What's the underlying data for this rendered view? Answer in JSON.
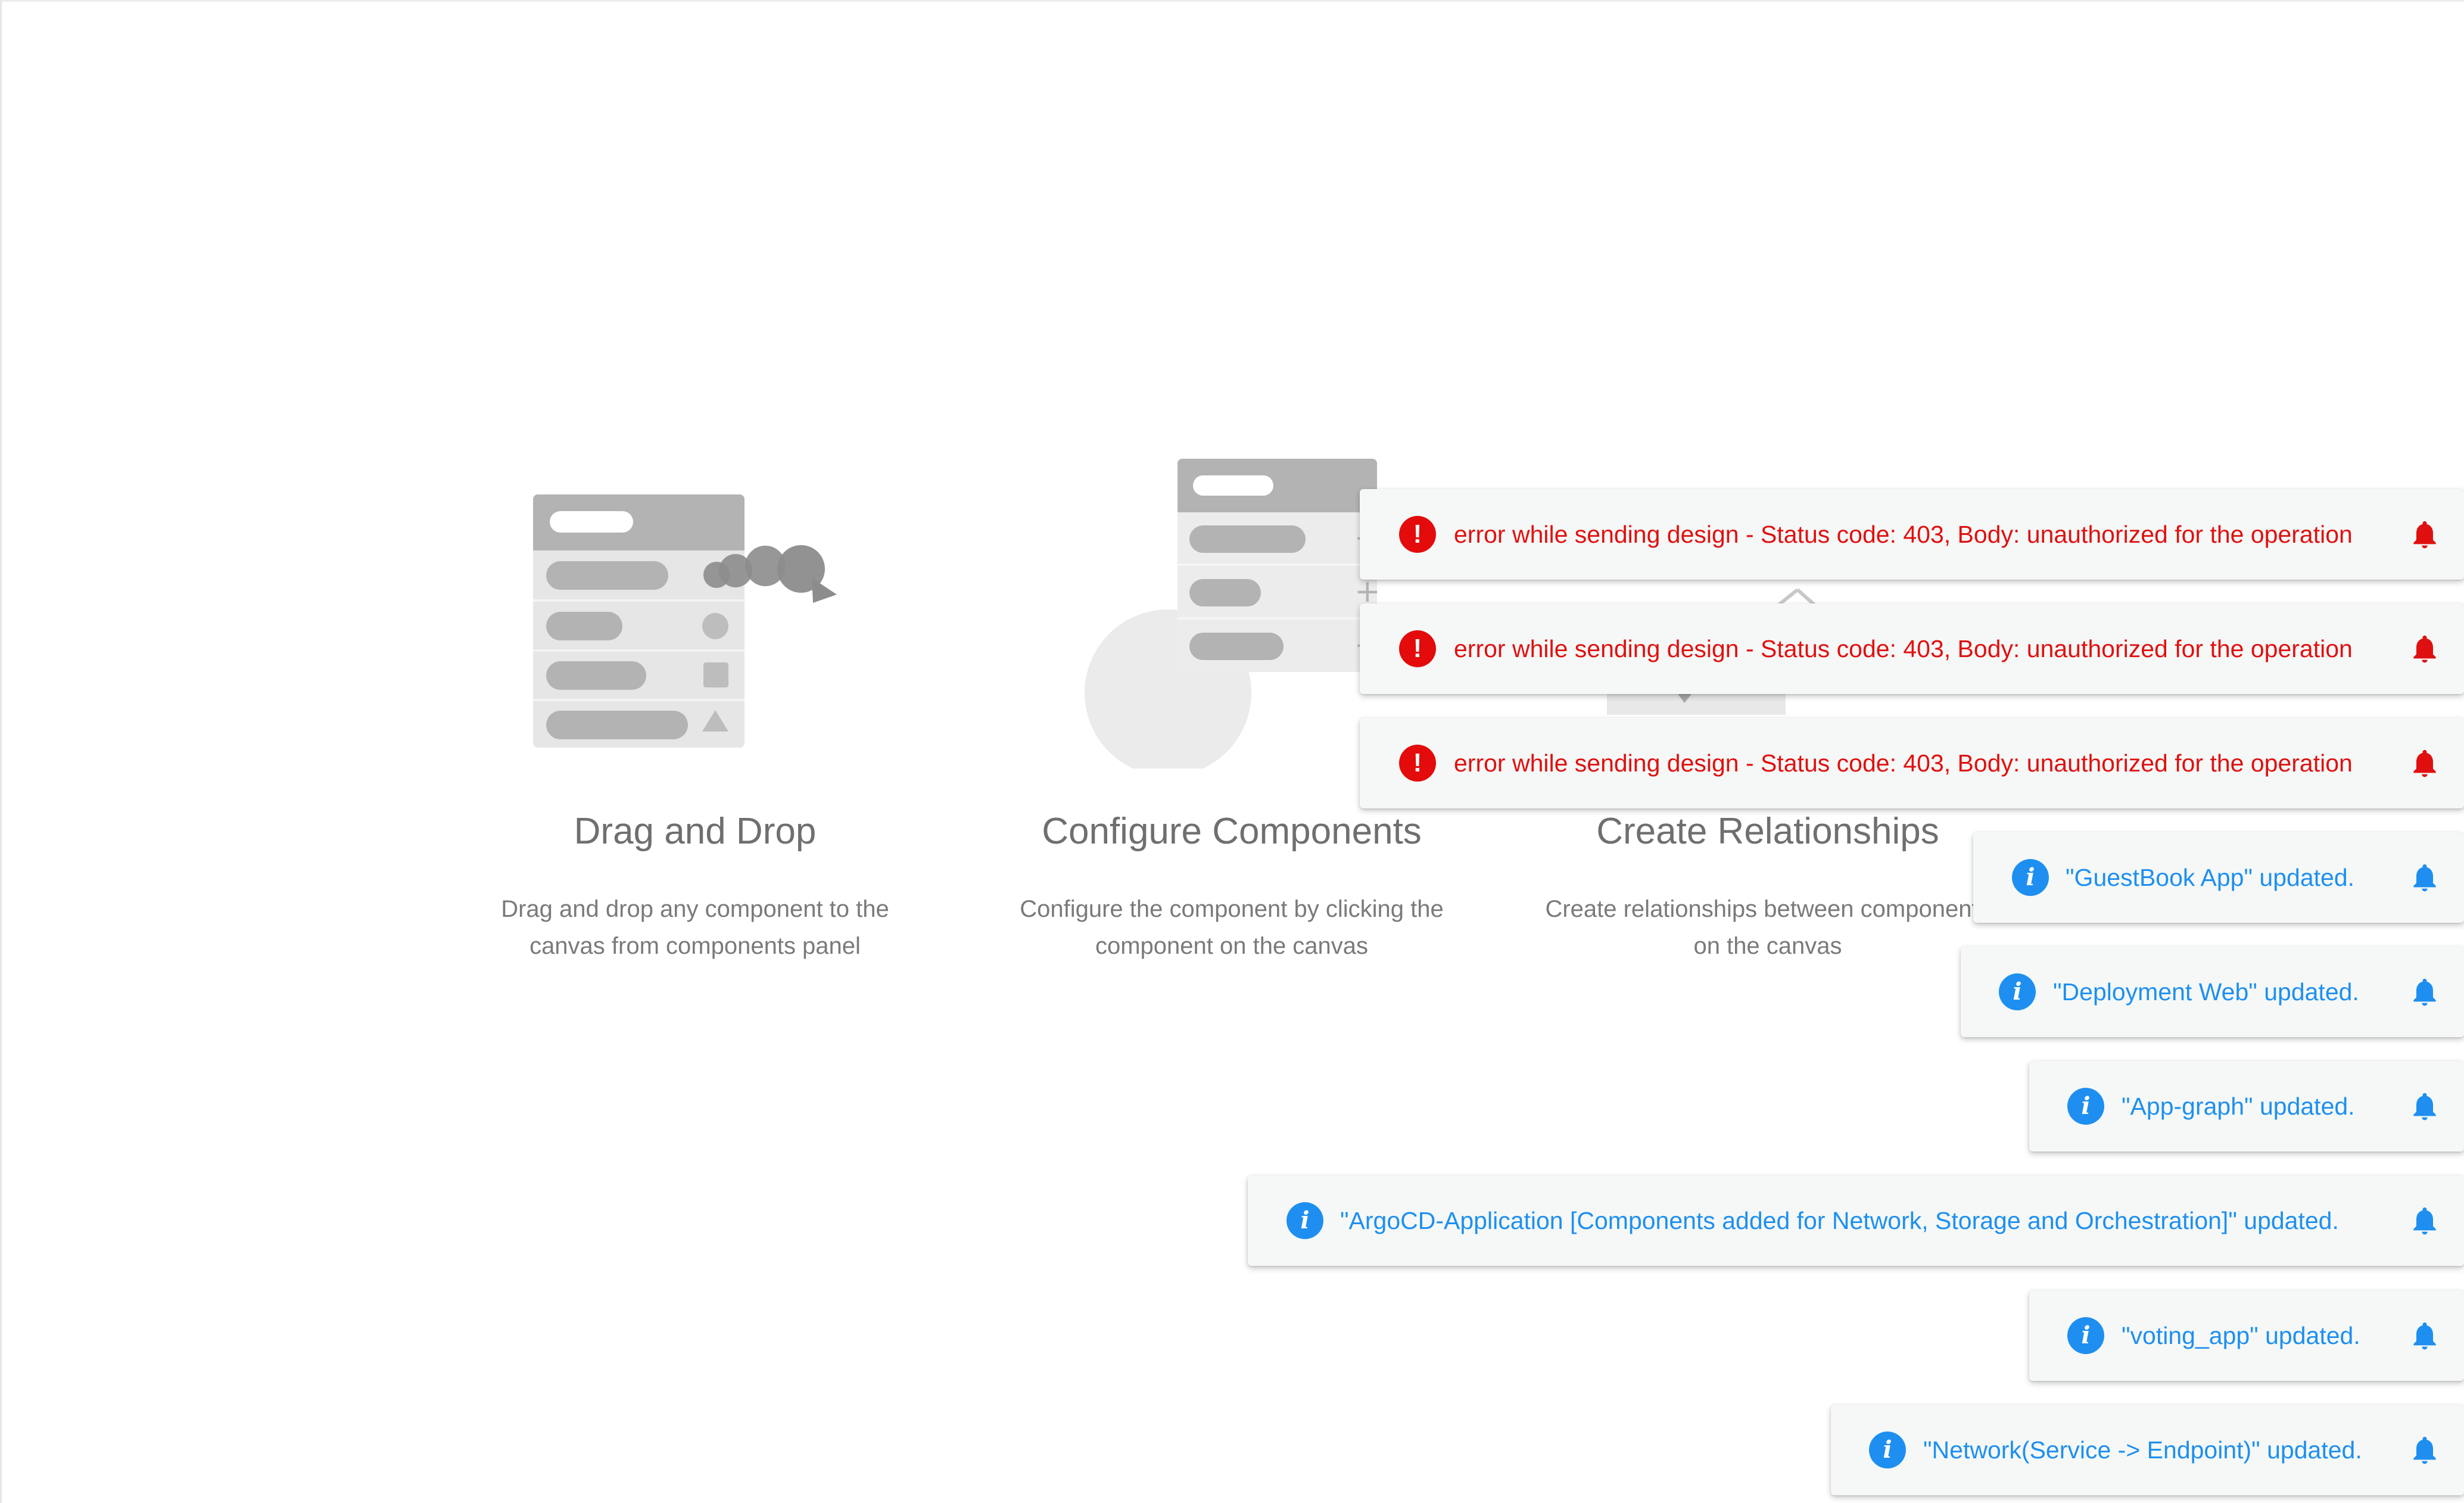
{
  "cards": [
    {
      "title": "Drag and Drop",
      "desc_line1": "Drag and drop any component to the",
      "desc_line2": "canvas from components panel"
    },
    {
      "title": "Configure Components",
      "desc_line1": "Configure the component by clicking the",
      "desc_line2": "component on the canvas"
    },
    {
      "title": "Create Relationships",
      "desc_line1": "Create relationships between components",
      "desc_line2": "on the canvas"
    }
  ],
  "notifications": [
    {
      "type": "error",
      "icon": "error-icon",
      "message": "error while sending design - Status code: 403, Body: unauthorized for the operation"
    },
    {
      "type": "error",
      "icon": "error-icon",
      "message": "error while sending design - Status code: 403, Body: unauthorized for the operation"
    },
    {
      "type": "error",
      "icon": "error-icon",
      "message": "error while sending design - Status code: 403, Body: unauthorized for the operation"
    },
    {
      "type": "info",
      "icon": "info-icon",
      "message": "\"GuestBook App\" updated."
    },
    {
      "type": "info",
      "icon": "info-icon",
      "message": "\"Deployment Web\" updated."
    },
    {
      "type": "info",
      "icon": "info-icon",
      "message": "\"App-graph\" updated."
    },
    {
      "type": "info",
      "icon": "info-icon",
      "message": "\"ArgoCD-Application [Components added for Network, Storage and Orchestration]\" updated."
    },
    {
      "type": "info",
      "icon": "info-icon",
      "message": "\"voting_app\" updated."
    },
    {
      "type": "info",
      "icon": "info-icon",
      "message": "\"Network(Service -> Endpoint)\" updated."
    }
  ],
  "icon_glyphs": {
    "error": "!",
    "info": "i"
  },
  "colors": {
    "error": "#e01010",
    "info": "#1e8ff0",
    "toast_bg": "#f5f8f6",
    "illustration": "#b0b0b0"
  }
}
